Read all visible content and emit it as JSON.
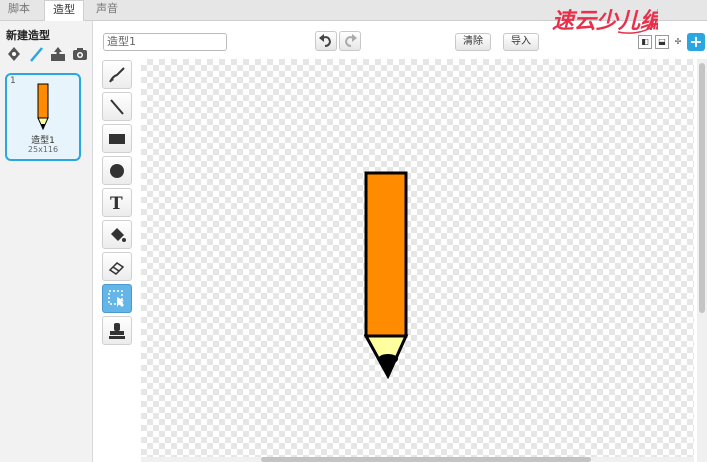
{
  "tabs": [
    {
      "label": "脚本",
      "active": false
    },
    {
      "label": "造型",
      "active": true
    },
    {
      "label": "声音",
      "active": false
    }
  ],
  "left_panel": {
    "title": "新建造型",
    "new_icons": [
      "paint-new-icon",
      "paintbrush-icon",
      "upload-icon",
      "camera-icon"
    ],
    "costume": {
      "number": "1",
      "name": "造型1",
      "size": "25x116"
    }
  },
  "toolbar": {
    "name_value": "造型1",
    "clear_label": "清除",
    "import_label": "导入",
    "logo_text": "速云少儿编程"
  },
  "tools": [
    "brush-icon",
    "line-icon",
    "rectangle-icon",
    "ellipse-icon",
    "text-icon",
    "fill-bucket-icon",
    "eraser-icon",
    "select-icon",
    "stamp-icon"
  ],
  "selected_tool": "select-icon",
  "colors": {
    "accent": "#2aa6e0",
    "pencil_body": "#ff8c00",
    "pencil_wood": "#ffffa0",
    "logo": "#e8304a"
  }
}
